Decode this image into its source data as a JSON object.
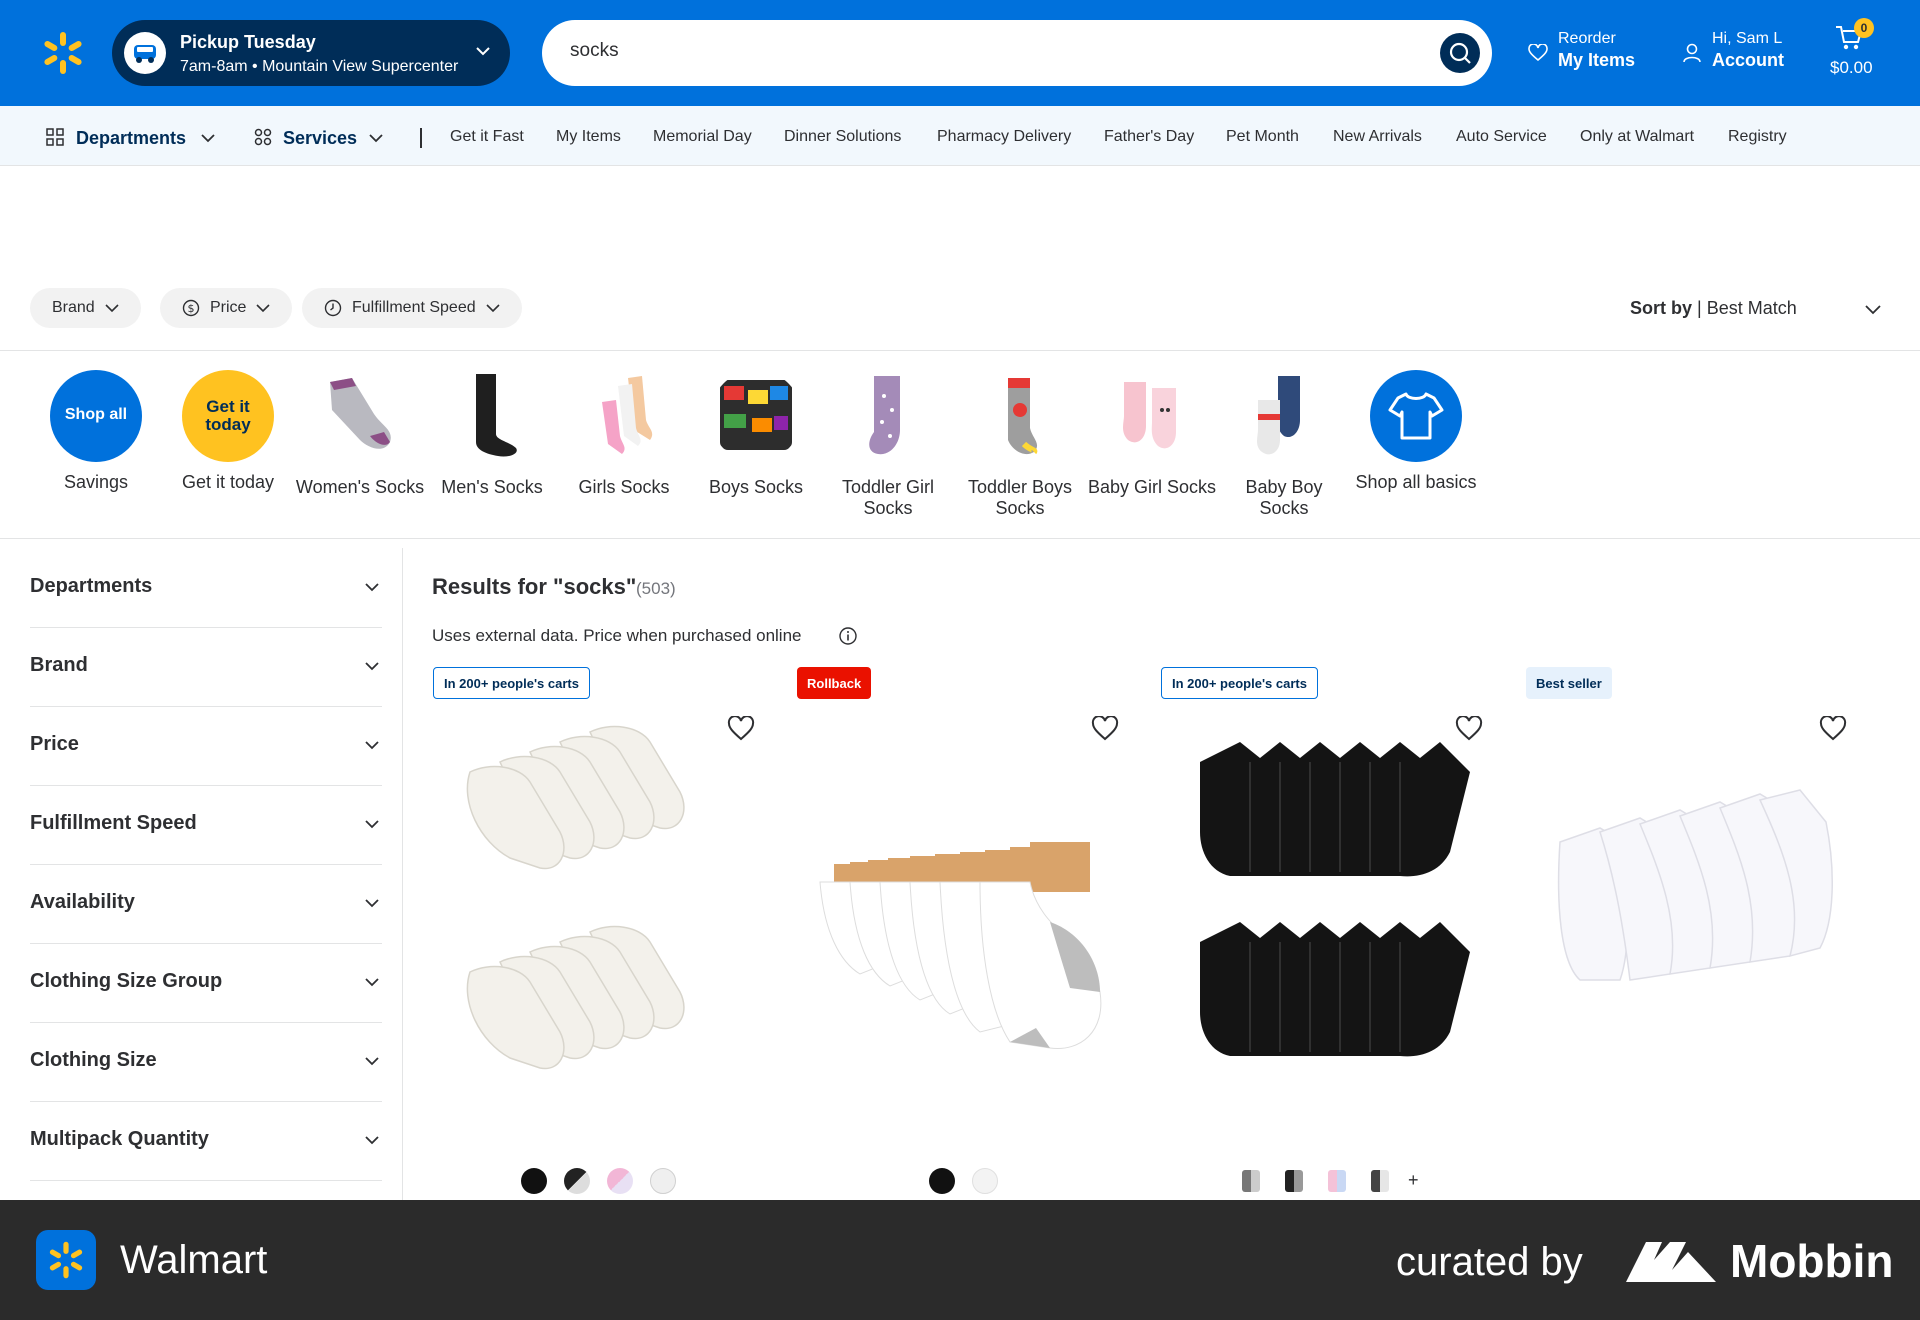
{
  "header": {
    "pickup_title": "Pickup Tuesday",
    "pickup_sub": "7am-8am • Mountain View Supercenter",
    "search_value": "socks",
    "reorder_small": "Reorder",
    "reorder_big": "My Items",
    "account_small": "Hi, Sam L",
    "account_big": "Account",
    "cart_count": "0",
    "cart_total": "$0.00",
    "brand_color": "#0071dc",
    "accent_color": "#ffc220"
  },
  "nav": {
    "departments": "Departments",
    "services": "Services",
    "items": [
      "Get it Fast",
      "My Items",
      "Memorial Day",
      "Dinner Solutions",
      "Pharmacy Delivery",
      "Father's Day",
      "Pet Month",
      "New Arrivals",
      "Auto Service",
      "Only at Walmart",
      "Registry"
    ]
  },
  "filters": {
    "brand": "Brand",
    "price": "Price",
    "fulfillment": "Fulfillment Speed",
    "sort_label": "Sort by",
    "sort_value": "| Best Match"
  },
  "categories": [
    {
      "label": "Savings",
      "inner": "Shop all"
    },
    {
      "label": "Get it today",
      "inner": "Get it today"
    },
    {
      "label": "Women's Socks"
    },
    {
      "label": "Men's Socks"
    },
    {
      "label": "Girls Socks"
    },
    {
      "label": "Boys Socks"
    },
    {
      "label": "Toddler Girl Socks"
    },
    {
      "label": "Toddler Boys Socks"
    },
    {
      "label": "Baby Girl Socks"
    },
    {
      "label": "Baby Boy Socks"
    },
    {
      "label": "Shop all basics"
    }
  ],
  "sidebar": [
    "Departments",
    "Brand",
    "Price",
    "Fulfillment Speed",
    "Availability",
    "Clothing Size Group",
    "Clothing Size",
    "Multipack Quantity"
  ],
  "results": {
    "title": "Results for \"socks\"",
    "count": "(503)",
    "note": "Uses external data. Price when purchased online",
    "badges": [
      "In 200+ people's carts",
      "Rollback",
      "In 200+ people's carts",
      "Best seller"
    ],
    "more_swatches": "+"
  },
  "footer": {
    "app": "Walmart",
    "curated": "curated by",
    "brand": "Mobbin"
  }
}
